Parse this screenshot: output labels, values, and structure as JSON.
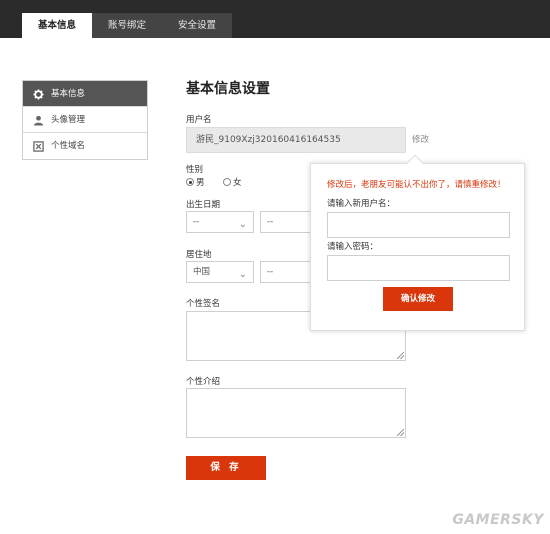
{
  "tabs": [
    {
      "label": "基本信息",
      "active": true
    },
    {
      "label": "账号绑定",
      "active": false
    },
    {
      "label": "安全设置",
      "active": false
    }
  ],
  "sidebar": {
    "items": [
      {
        "label": "基本信息",
        "icon": "gear-icon",
        "active": true
      },
      {
        "label": "头像管理",
        "icon": "user-icon",
        "active": false
      },
      {
        "label": "个性域名",
        "icon": "domain-icon",
        "active": false
      }
    ]
  },
  "form": {
    "title": "基本信息设置",
    "username_label": "用户名",
    "username_value": "游民_9109Xzj320160416164535",
    "edit_link": "修改",
    "gender_label": "性别",
    "gender_male": "男",
    "gender_female": "女",
    "gender_selected": "男",
    "birthday_label": "出生日期",
    "birthday_year": "--",
    "birthday_month": "--",
    "residence_label": "居住地",
    "residence_country": "中国",
    "residence_region": "--",
    "signature_label": "个性签名",
    "intro_label": "个性介绍",
    "save_label": "保 存"
  },
  "popup": {
    "warning": "修改后，老朋友可能认不出你了，请慎重修改！",
    "new_username_label": "请输入新用户名：",
    "password_label": "请输入密码：",
    "confirm_label": "确认修改"
  },
  "colors": {
    "accent": "#d9360b",
    "topbar": "#2b2b2b",
    "sidebar_active": "#555555"
  },
  "watermark": "GAMERSKY"
}
